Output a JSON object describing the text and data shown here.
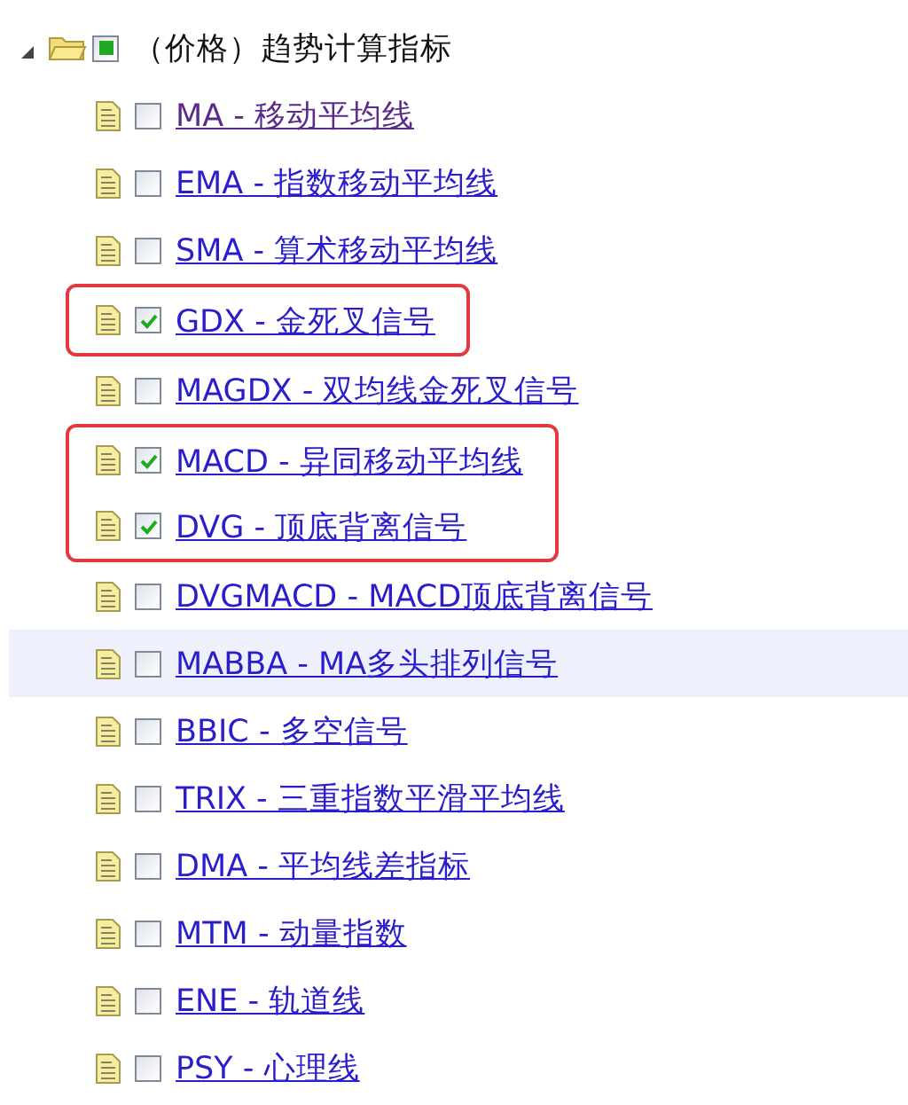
{
  "tree": {
    "label": "（价格）趋势计算指标",
    "expanded": true,
    "checked": false,
    "partial": true,
    "children": [
      {
        "kind": "item",
        "label": "MA - 移动平均线",
        "checked": false,
        "visited": true,
        "hovered": false
      },
      {
        "kind": "item",
        "label": "EMA - 指数移动平均线",
        "checked": false,
        "visited": false,
        "hovered": false
      },
      {
        "kind": "item",
        "label": "SMA - 算术移动平均线",
        "checked": false,
        "visited": false,
        "hovered": false
      },
      {
        "kind": "outlined_group",
        "items": [
          {
            "label": "GDX - 金死叉信号",
            "checked": true,
            "visited": false,
            "hovered": false
          }
        ]
      },
      {
        "kind": "item",
        "label": "MAGDX - 双均线金死叉信号",
        "checked": false,
        "visited": false,
        "hovered": false
      },
      {
        "kind": "outlined_group",
        "items": [
          {
            "label": "MACD - 异同移动平均线",
            "checked": true,
            "visited": false,
            "hovered": false
          },
          {
            "label": "DVG - 顶底背离信号",
            "checked": true,
            "visited": false,
            "hovered": false
          }
        ]
      },
      {
        "kind": "item",
        "label": "DVGMACD - MACD顶底背离信号",
        "checked": false,
        "visited": false,
        "hovered": false
      },
      {
        "kind": "item",
        "label": "MABBA - MA多头排列信号",
        "checked": false,
        "visited": false,
        "hovered": true
      },
      {
        "kind": "item",
        "label": "BBIC - 多空信号",
        "checked": false,
        "visited": false,
        "hovered": false
      },
      {
        "kind": "item",
        "label": "TRIX - 三重指数平滑平均线",
        "checked": false,
        "visited": false,
        "hovered": false
      },
      {
        "kind": "item",
        "label": "DMA - 平均线差指标",
        "checked": false,
        "visited": false,
        "hovered": false
      },
      {
        "kind": "item",
        "label": "MTM - 动量指数",
        "checked": false,
        "visited": false,
        "hovered": false
      },
      {
        "kind": "item",
        "label": "ENE - 轨道线",
        "checked": false,
        "visited": false,
        "hovered": false
      },
      {
        "kind": "item",
        "label": "PSY - 心理线",
        "checked": false,
        "visited": false,
        "hovered": false
      }
    ]
  }
}
